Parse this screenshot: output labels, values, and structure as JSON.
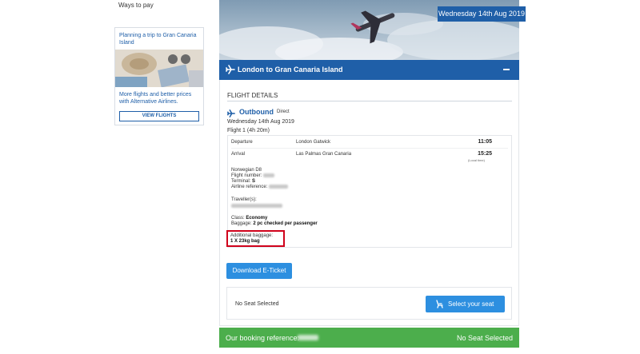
{
  "sidebar": {
    "ways_to_pay": "Ways to pay",
    "promo": {
      "title": "Planning a trip to Gran Canaria Island",
      "text": "More flights and better prices with Alternative Airlines.",
      "button": "VIEW FLIGHTS"
    }
  },
  "hero": {
    "date": "Wednesday 14th Aug 2019"
  },
  "route": {
    "title": "London to Gran Canaria Island",
    "collapse_icon": "minus-icon",
    "plane_icon": "plane-icon"
  },
  "details": {
    "heading": "FLIGHT DETAILS",
    "outbound": {
      "label": "Outbound",
      "type": "Direct",
      "date": "Wednesday 14th Aug 2019",
      "flight": "Flight 1 (4h 20m)"
    },
    "departure": {
      "label": "Departure",
      "place": "London Gatwick",
      "time": "11:05"
    },
    "arrival": {
      "label": "Arrival",
      "place": "Las Palmas Gran Canaria",
      "time": "15:25",
      "note": "(Local time)"
    },
    "airline": {
      "name": "Norwegian D8",
      "flight_number_label": "Flight number:",
      "terminal_label": "Terminal:",
      "terminal_value": "S",
      "reference_label": "Airline reference:"
    },
    "travellers_label": "Traveller(s):",
    "class_label": "Class:",
    "class_value": "Economy",
    "baggage_label": "Baggage:",
    "baggage_value": "2 pc checked per passenger",
    "additional_label": "Additional baggage:",
    "additional_value": "1 X 23kg bag"
  },
  "actions": {
    "eticket": "Download E-Ticket"
  },
  "seat": {
    "status": "No Seat Selected",
    "button": "Select your seat",
    "icon": "seat-icon"
  },
  "booking": {
    "label": "Our booking reference:",
    "seat_status": "No Seat Selected"
  },
  "colors": {
    "primary": "#1f5fa8",
    "button": "#2d8fe0",
    "success": "#4cae4c",
    "highlight": "#d0021b"
  }
}
